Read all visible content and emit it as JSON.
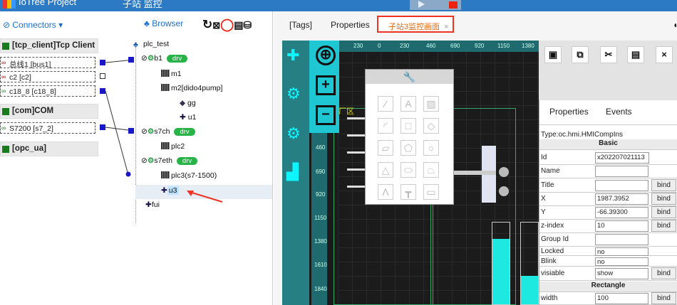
{
  "app": {
    "title": "IoTree Project",
    "subtitle": "子站 监控"
  },
  "left": {
    "connectors_label": "Connectors",
    "browser_label": "Browser",
    "connections": [
      {
        "name": "[tcp_client]Tcp Client"
      },
      {
        "name": "[com]COM"
      },
      {
        "name": "[opc_ua]"
      }
    ],
    "buses": [
      "总线1 [bus1]",
      "c2 [c2]",
      "c18_8 [c18_8]",
      "S7200 [s7_2]"
    ],
    "tree": {
      "root": "plc_test",
      "b1": "b1",
      "drv": "drv",
      "m1": "m1",
      "m2": "m2[dido4pump]",
      "gg": "gg",
      "u1": "u1",
      "s7ch": "s7ch",
      "plc2": "plc2",
      "s7eth": "s7eth",
      "plc3": "plc3(s7-1500)",
      "u3": "u3",
      "fui": "fui"
    }
  },
  "tabs": {
    "tags": "[Tags]",
    "properties": "Properties",
    "active": "子站3监控画面"
  },
  "canvas": {
    "ruler_top": [
      "230",
      "0",
      "230",
      "460",
      "690",
      "920",
      "1150",
      "1380"
    ],
    "ruler_left": [
      "460",
      "690",
      "920",
      "1150",
      "1380",
      "1610",
      "1840"
    ],
    "label": "厂区"
  },
  "props": {
    "tab_properties": "Properties",
    "tab_events": "Events",
    "type": "Type:oc.hmi.HMICompIns",
    "basic": "Basic",
    "rectangle": "Rectangle",
    "bind": "bind",
    "rows": {
      "id": {
        "k": "Id",
        "v": "x202207021113"
      },
      "name": {
        "k": "Name",
        "v": ""
      },
      "title": {
        "k": "Title",
        "v": ""
      },
      "x": {
        "k": "X",
        "v": "1987.3952"
      },
      "y": {
        "k": "Y",
        "v": "-66.39300"
      },
      "z": {
        "k": "z-index",
        "v": "10"
      },
      "group": {
        "k": "Group Id",
        "v": ""
      },
      "locked": {
        "k": "Locked",
        "v": "no"
      },
      "blink": {
        "k": "Blink",
        "v": "no"
      },
      "visible": {
        "k": "visiable",
        "v": "show"
      },
      "width": {
        "k": "width",
        "v": "100"
      }
    }
  },
  "colors": {
    "accent": "#2c79c4",
    "teal": "#267f83",
    "cyan": "#1ec7d2",
    "drv": "#27b347",
    "highlight": "#e32222"
  }
}
